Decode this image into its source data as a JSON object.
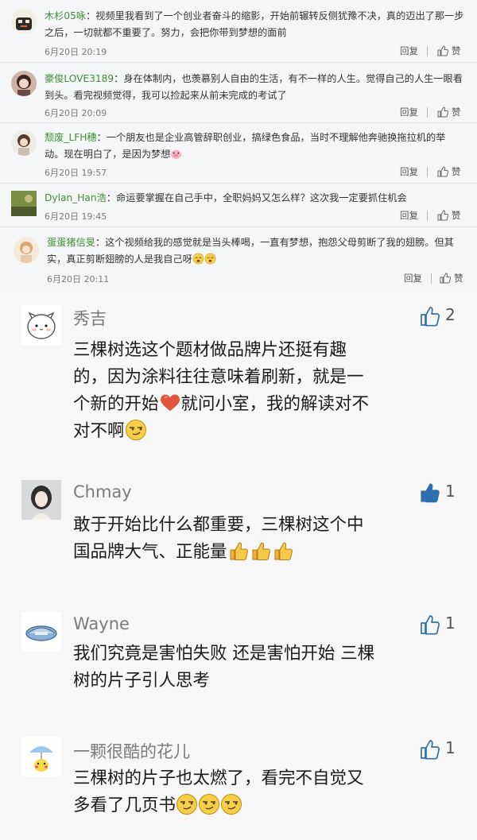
{
  "weibo": {
    "reply_label": "回复",
    "like_label": "赞",
    "comments": [
      {
        "user": "木杉05咏",
        "sep": "：",
        "line1": "视频里我看到了一个创业者奋斗的缩影，开始前辗转反侧犹豫不决，真的迈出了那一步",
        "line2": "之后，一切就都不重要了。努力，会把你带到梦想的面前",
        "time": "6月20日 20:19"
      },
      {
        "user": "豪俊LOVE3189",
        "sep": "：",
        "line1": "身在体制内，也羡慕别人自由的生活，有不一样的人生。觉得自己的人生一眼看",
        "line2": "到头。看完视频觉得，我可以捡起来从前未完成的考试了",
        "time": "6月20日 20:09"
      },
      {
        "user": "颓废_LFH穗",
        "sep": "：",
        "line1": "一个朋友也是企业高管辞职创业，搞绿色食品，当时不理解他奔驰换拖拉机的举",
        "line2": "动。现在明白了，是因为梦想",
        "time": "6月20日 19:57"
      },
      {
        "user": "Dylan_Han浩",
        "sep": "：",
        "line1": "命运要掌握在自己手中，全职妈妈又怎么样？这次我一定要抓住机会",
        "line2": "",
        "time": "6月20日 19:45"
      },
      {
        "user": "蛋蛋猪信旻",
        "sep": "：",
        "line1": "这个视频给我的感觉就是当头棒喝，一直有梦想，抱怨父母剪断了我的翅膀。但其",
        "line2": "实，真正剪断翅膀的人是我自己呀",
        "time": "6月20日 20:11"
      }
    ]
  },
  "wechat": {
    "comments": [
      {
        "name": "秀吉",
        "likes": "2",
        "liked": false,
        "lines": [
          "三棵树选这个题材做品牌片还挺有趣",
          "的，因为涂料往往意味着刷新，就是一",
          "个新的开始",
          "就问小室，我的解读对不",
          "对不啊"
        ]
      },
      {
        "name": "Chmay",
        "likes": "1",
        "liked": true,
        "lines": [
          "敢于开始比什么都重要，三棵树这个中",
          "国品牌大气、正能量"
        ]
      },
      {
        "name": "Wayne",
        "likes": "1",
        "liked": false,
        "lines": [
          "我们究竟是害怕失败 还是害怕开始 三棵",
          "树的片子引人思考"
        ]
      },
      {
        "name": "一颗很酷的花儿",
        "likes": "1",
        "liked": false,
        "lines": [
          "三棵树的片子也太燃了，看完不自觉又",
          "多看了几页书"
        ]
      }
    ]
  },
  "colors": {
    "username_green": "#3f8e34",
    "heart": "#e2553d",
    "like_blue": "#2f6fb0"
  }
}
